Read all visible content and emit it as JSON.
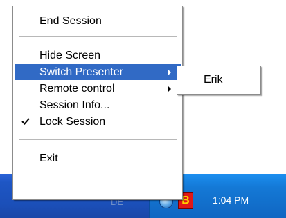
{
  "menu": {
    "items": [
      {
        "label": "End Session"
      },
      {
        "label": "Hide Screen"
      },
      {
        "label": "Switch Presenter"
      },
      {
        "label": "Remote control"
      },
      {
        "label": "Session Info..."
      },
      {
        "label": "Lock Session",
        "checked": true
      },
      {
        "label": "Exit"
      }
    ],
    "highlight_color": "#316ac5"
  },
  "submenu": {
    "items": [
      {
        "label": "Erik"
      }
    ]
  },
  "taskbar": {
    "faded_label": "DE",
    "clock": "1:04 PM",
    "tray_icons": [
      "globe-icon",
      "b-app-icon"
    ],
    "tray_letter": "B"
  }
}
